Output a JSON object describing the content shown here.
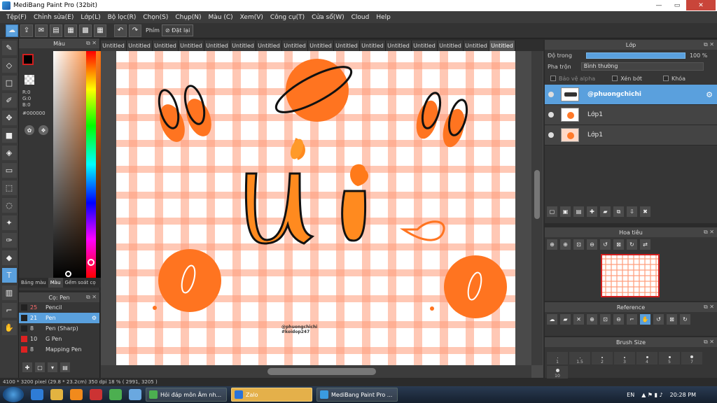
{
  "window": {
    "title": "MediBang Paint Pro (32bit)",
    "min": "—",
    "max": "▭",
    "close": "✕"
  },
  "menu": [
    "Tệp(F)",
    "Chỉnh sửa(E)",
    "Lớp(L)",
    "Bộ lọc(R)",
    "Chọn(S)",
    "Chụp(N)",
    "Màu (C)",
    "Xem(V)",
    "Công cụ(T)",
    "Cửa sổ(W)",
    "Cloud",
    "Help"
  ],
  "toolbar": {
    "key_label": "Phím",
    "reset_label": "Đặt lại"
  },
  "color_panel": {
    "title": "Màu",
    "rgb_r": "R:0",
    "rgb_g": "G:0",
    "rgb_b": "B:0",
    "hex": "#000000",
    "tabs": [
      "Bảng màu",
      "Màu",
      "Gềm soát cọ"
    ]
  },
  "brush_panel": {
    "title": "Cọ: Pen",
    "items": [
      {
        "size": "25",
        "name": "Pencil",
        "color": "#222222"
      },
      {
        "size": "21",
        "name": "Pen",
        "color": "#222222"
      },
      {
        "size": "8",
        "name": "Pen (Sharp)",
        "color": "#222222"
      },
      {
        "size": "10",
        "name": "G Pen",
        "color": "#dd2222"
      },
      {
        "size": "8",
        "name": "Mapping Pen",
        "color": "#dd2222"
      }
    ]
  },
  "doc_tabs": [
    "Untitled",
    "Untitled",
    "Untitled",
    "Untitled",
    "Untitled",
    "Untitled",
    "Untitled",
    "Untitled",
    "Untitled",
    "Untitled",
    "Untitled",
    "Untitled",
    "Untitled",
    "Untitled",
    "Untitled",
    "Untitled"
  ],
  "canvas": {
    "watermark_1": "@phuongchichi",
    "watermark_2": "#koidop247"
  },
  "status": "4100 * 3200 pixel   (29.8 * 23.2cm)   350 dpi   18 %   ( 2991, 3205 )",
  "layer_panel": {
    "title": "Lớp",
    "opacity_label": "Độ trong",
    "opacity_value": "100 %",
    "blend_label": "Pha trộn",
    "blend_value": "Bình thường",
    "protect_alpha": "Bảo vệ alpha",
    "clipping": "Xén bớt",
    "lock": "Khóa",
    "layers": [
      "@phuongchichi",
      "Lớp1",
      "Lớp1"
    ]
  },
  "navigator": {
    "title": "Hoa tiêu"
  },
  "reference": {
    "title": "Reference"
  },
  "brush_size": {
    "title": "Brush Size",
    "sizes": [
      "1",
      "1.5",
      "2",
      "3",
      "4",
      "5",
      "7",
      "10"
    ]
  },
  "taskbar": {
    "tasks": [
      "Hỏi đáp môn Âm nh...",
      "Zalo",
      "MediBang Paint Pro ..."
    ],
    "lang": "EN",
    "time": "20:28 PM"
  },
  "colors": {
    "accent": "#5aa0dd",
    "orange": "#ff7420",
    "grid": "#ffb79a"
  }
}
